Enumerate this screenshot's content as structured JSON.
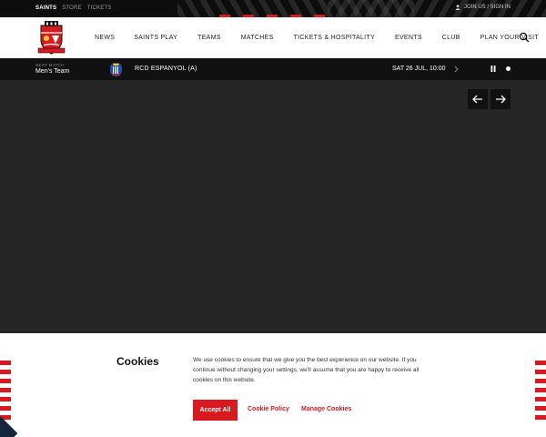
{
  "topbar": {
    "links": [
      "SAINTS",
      "STORE",
      "TICKETS"
    ],
    "account_label": "JOIN US / SIGN IN"
  },
  "nav": {
    "items": [
      "NEWS",
      "SAINTS PLAY",
      "TEAMS",
      "MATCHES",
      "TICKETS & HOSPITALITY",
      "EVENTS",
      "CLUB",
      "PLAN YOUR VISIT"
    ]
  },
  "next_match": {
    "label": "NEXT MATCH",
    "team": "Men's Team",
    "opponent": "RCD ESPANYOL (A)",
    "date": "SAT 26 JUL, 10:00"
  },
  "cookie": {
    "title": "Cookies",
    "text": "We use cookies to ensure that we give you the best experience on our website. If you continue without changing your settings, we'll assume that you are happy to receive all cookies on this website.",
    "accept_label": "Accept All",
    "policy_label": "Cookie Policy",
    "manage_label": "Manage Cookies"
  },
  "colors": {
    "brand_red": "#d71920",
    "dark": "#111111",
    "hero_bg": "#262626"
  },
  "icons": [
    "user-icon",
    "crest-icon",
    "search-icon",
    "espanyol-badge-icon",
    "chevron-right-icon",
    "pause-icon",
    "arrow-left-icon",
    "arrow-right-icon"
  ]
}
